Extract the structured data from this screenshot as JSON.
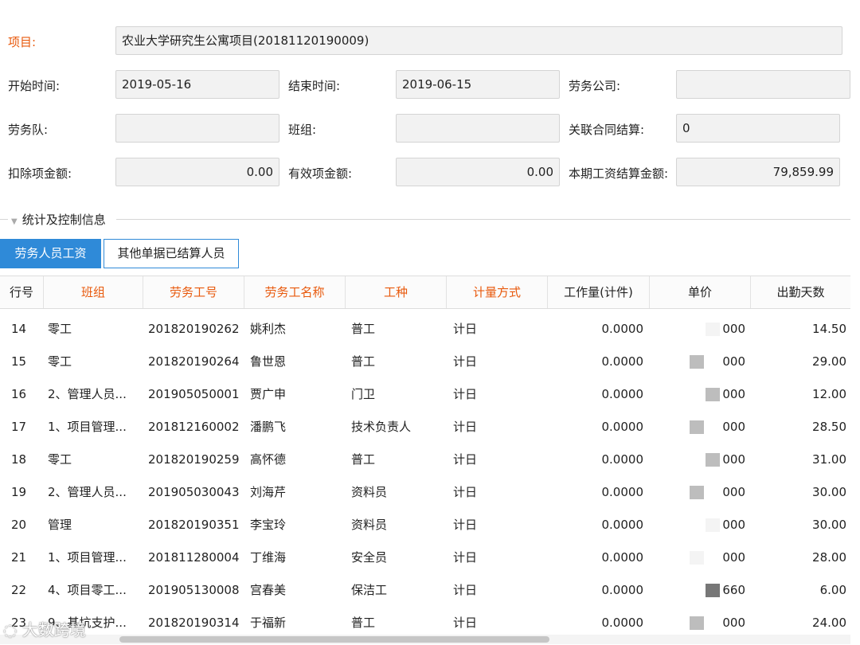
{
  "form": {
    "project_label": "项目:",
    "project_value": "农业大学研究生公寓项目(20181120190009)",
    "start_label": "开始时间:",
    "start_value": "2019-05-16",
    "end_label": "结束时间:",
    "end_value": "2019-06-15",
    "company_label": "劳务公司:",
    "company_value": "",
    "team_label": "劳务队:",
    "team_value": "",
    "group_label": "班组:",
    "group_value": "",
    "contract_label": "关联合同结算:",
    "contract_value": "0",
    "deduct_label": "扣除项金额:",
    "deduct_value": "0.00",
    "valid_label": "有效项金额:",
    "valid_value": "0.00",
    "period_label": "本期工资结算金额:",
    "period_value": "79,859.99"
  },
  "section": {
    "title": "统计及控制信息"
  },
  "tabs": [
    {
      "label": "劳务人员工资",
      "active": true
    },
    {
      "label": "其他单据已结算人员",
      "active": false
    }
  ],
  "table": {
    "headers": [
      "行号",
      "班组",
      "劳务工号",
      "劳务工名称",
      "工种",
      "计量方式",
      "工作量(计件)",
      "单价",
      "出勤天数"
    ],
    "rows": [
      [
        "14",
        "零工",
        "201820190262",
        "姚利杰",
        "普工",
        "计日",
        "0.0000",
        "000",
        "14.50"
      ],
      [
        "15",
        "零工",
        "201820190264",
        "鲁世恩",
        "普工",
        "计日",
        "0.0000",
        "000",
        "29.00"
      ],
      [
        "16",
        "2、管理人员...",
        "201905050001",
        "贾广申",
        "门卫",
        "计日",
        "0.0000",
        "000",
        "12.00"
      ],
      [
        "17",
        "1、项目管理...",
        "201812160002",
        "潘鹏飞",
        "技术负责人",
        "计日",
        "0.0000",
        "000",
        "28.50"
      ],
      [
        "18",
        "零工",
        "201820190259",
        "高怀德",
        "普工",
        "计日",
        "0.0000",
        "000",
        "31.00"
      ],
      [
        "19",
        "2、管理人员...",
        "201905030043",
        "刘海芹",
        "资料员",
        "计日",
        "0.0000",
        "000",
        "30.00"
      ],
      [
        "20",
        "管理",
        "201820190351",
        "李宝玲",
        "资料员",
        "计日",
        "0.0000",
        "000",
        "30.00"
      ],
      [
        "21",
        "1、项目管理...",
        "201811280004",
        "丁维海",
        "安全员",
        "计日",
        "0.0000",
        "000",
        "28.00"
      ],
      [
        "22",
        "4、项目零工...",
        "201905130008",
        "宫春美",
        "保洁工",
        "计日",
        "0.0000",
        "660",
        "6.00"
      ],
      [
        "23",
        "9、基坑支护...",
        "201820190314",
        "于福新",
        "普工",
        "计日",
        "0.0000",
        "000",
        "24.00"
      ]
    ]
  },
  "watermark": "大数跨境",
  "colors": {
    "accent": "#2f8ad8",
    "required": "#e8590c"
  }
}
